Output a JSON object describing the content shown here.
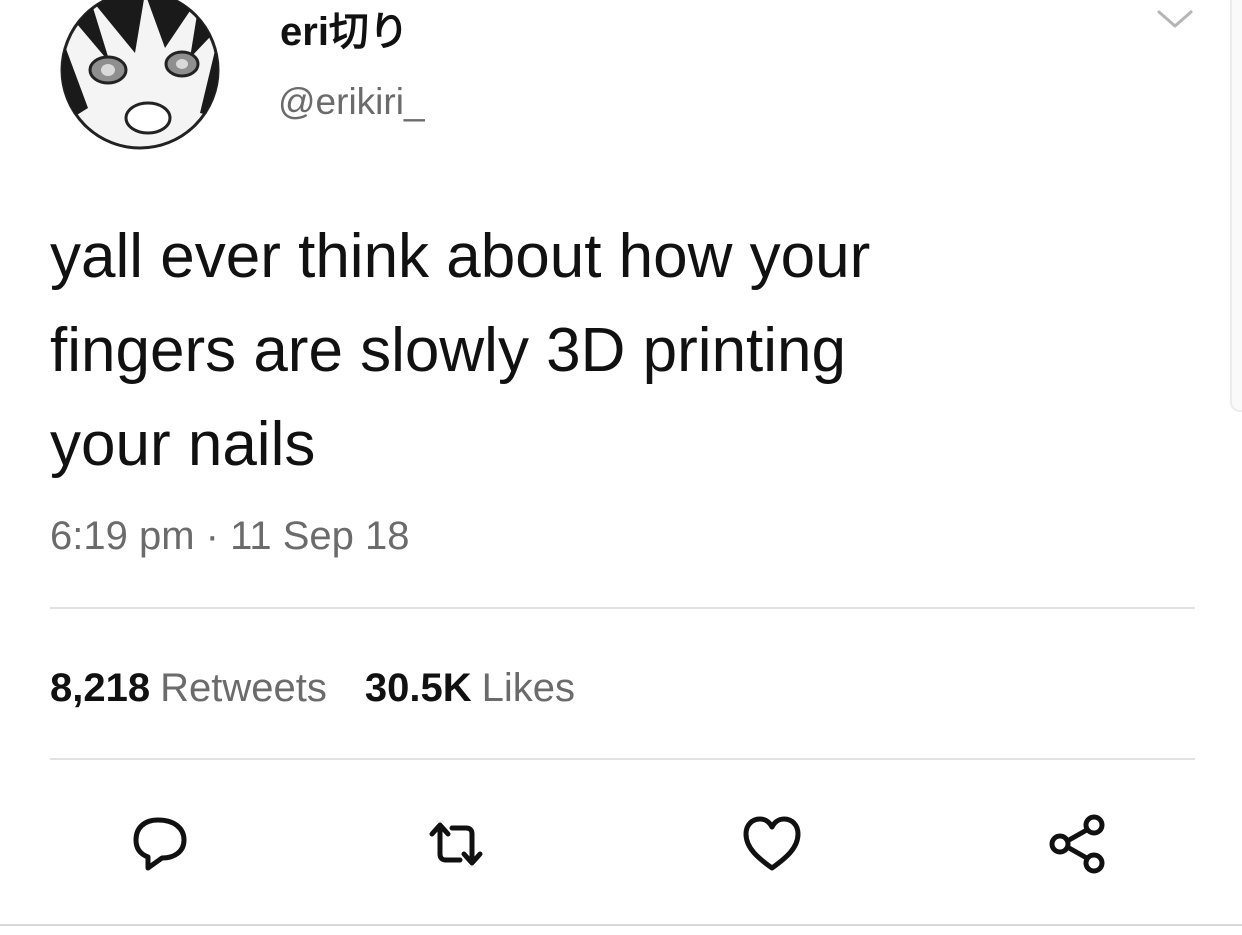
{
  "tweet": {
    "author": {
      "display_name": "eri切り",
      "handle": "@erikiri_",
      "avatar_icon": "anime-avatar-icon"
    },
    "text_lines": [
      "yall ever think about how your",
      "fingers are slowly 3D printing",
      "your nails"
    ],
    "timestamp": "6:19 pm · 11 Sep 18",
    "stats": {
      "retweets_count": "8,218",
      "retweets_label": "Retweets",
      "likes_count": "30.5K",
      "likes_label": "Likes"
    },
    "actions": [
      {
        "name": "reply",
        "icon": "speech-bubble-icon"
      },
      {
        "name": "retweet",
        "icon": "retweet-arrows-icon"
      },
      {
        "name": "like",
        "icon": "heart-icon"
      },
      {
        "name": "share",
        "icon": "share-nodes-icon"
      }
    ],
    "menu_icon": "chevron-down-icon"
  },
  "colors": {
    "text": "#111111",
    "secondary_text": "#6b6b6b",
    "divider": "#e2e2e2",
    "background": "#ffffff"
  }
}
